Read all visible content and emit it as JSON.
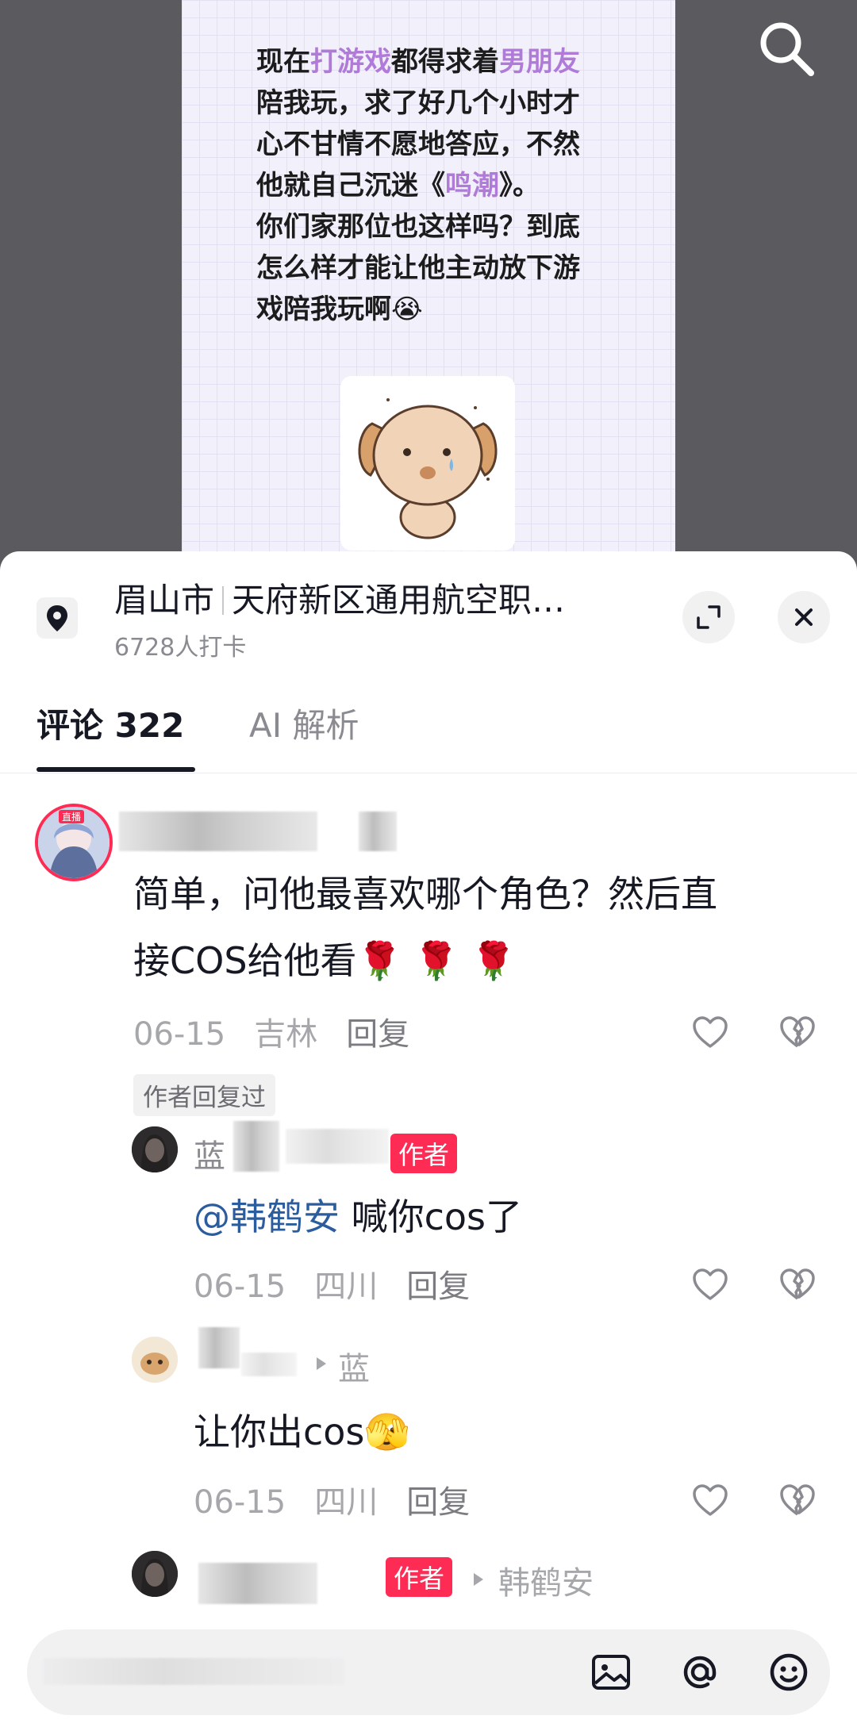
{
  "post": {
    "text_parts": [
      {
        "t": "现在",
        "hl": false
      },
      {
        "t": "打游戏",
        "hl": true
      },
      {
        "t": "都得求着",
        "hl": false
      },
      {
        "t": "男朋友",
        "hl": true
      },
      {
        "t": "\n陪我玩，求了好几个小时才\n心不甘情不愿地答应，不然\n他就自己沉迷《",
        "hl": false
      },
      {
        "t": "鸣潮",
        "hl": true
      },
      {
        "t": "》。\n你们家那位也这样吗？到底\n怎么样才能让他主动放下游\n戏陪我玩啊😭",
        "hl": false
      }
    ],
    "highlight_color": "#b07ad9"
  },
  "top": {
    "search_icon": "search-icon"
  },
  "location": {
    "city": "眉山市",
    "place": "天府新区通用航空职…",
    "checkins": "6728人打卡"
  },
  "tabs": {
    "comments": "评论 322",
    "ai": "AI 解析"
  },
  "comments": {
    "main": {
      "text": "简单，问他最喜欢哪个角色？然后直\n接COS给他看🌹 🌹 🌹",
      "date": "06-15",
      "region": "吉林",
      "reply": "回复",
      "author_replied": "作者回复过",
      "avatar_badge": "直播"
    },
    "reply1": {
      "name_visible": "蓝",
      "badge": "作者",
      "mention": "@韩鹤安",
      "text": " 喊你cos了",
      "date": "06-15",
      "region": "四川",
      "reply": "回复"
    },
    "reply2": {
      "reply_to_visible": "蓝",
      "text": "让你出cos🫣",
      "date": "06-15",
      "region": "四川",
      "reply": "回复"
    },
    "reply3": {
      "badge": "作者",
      "reply_to": "韩鹤安"
    }
  },
  "input_bar": {
    "placeholder": "",
    "icons": [
      "image-icon",
      "at-icon",
      "emoji-icon"
    ]
  },
  "colors": {
    "accent": "#fe2c55",
    "mention": "#2b5c9e",
    "meta": "#a6a7ab"
  }
}
